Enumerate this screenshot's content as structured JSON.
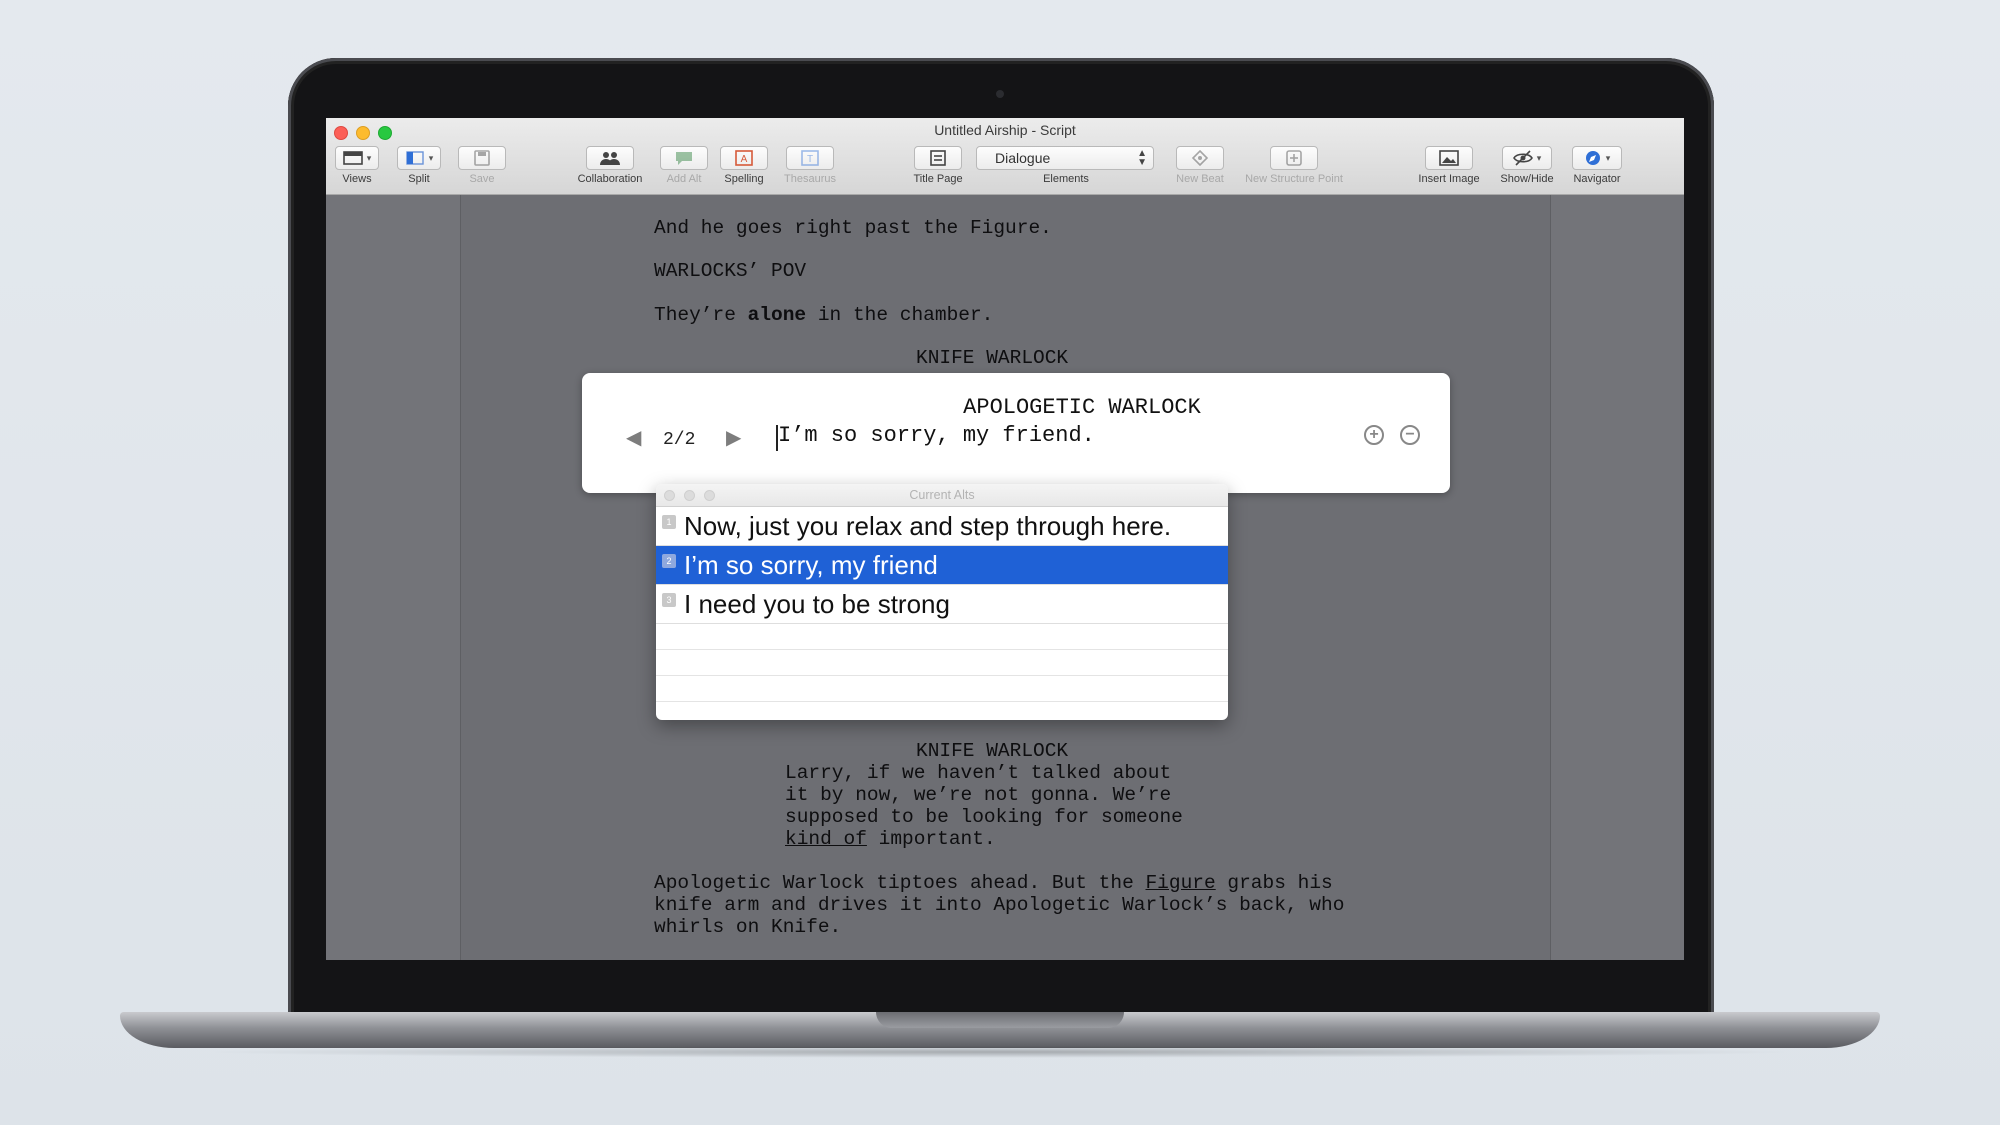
{
  "window": {
    "title": "Untitled Airship - Script"
  },
  "toolbar": {
    "views": "Views",
    "split": "Split",
    "save": "Save",
    "collaboration": "Collaboration",
    "add_alt": "Add Alt",
    "spelling": "Spelling",
    "thesaurus": "Thesaurus",
    "title_page": "Title Page",
    "elements_value": "Dialogue",
    "elements": "Elements",
    "new_beat": "New Beat",
    "new_structure_point": "New Structure Point",
    "insert_image": "Insert Image",
    "show_hide": "Show/Hide",
    "navigator": "Navigator"
  },
  "script": {
    "line1": "And he goes right past the Figure.",
    "line2": "WARLOCKS’ POV",
    "line3_a": "They’re ",
    "line3_b": "alone",
    "line3_c": " in the chamber.",
    "char1": "KNIFE WARLOCK",
    "char2": "KNIFE WARLOCK",
    "dlg1": "Larry, if we haven’t talked about",
    "dlg2": "it by now, we’re not gonna. We’re",
    "dlg3": "supposed to be looking for someone",
    "dlg4_a": "kind of",
    "dlg4_b": " important.",
    "act1_a": "Apologetic Warlock tiptoes ahead. But the ",
    "act1_b": "Figure",
    "act1_c": " grabs his",
    "act2": "knife arm and drives it into Apologetic Warlock’s back, who",
    "act3": "whirls on Knife."
  },
  "alt_popup": {
    "count": "2/2",
    "character": "APOLOGETIC WARLOCK",
    "line": "I’m so sorry, my friend."
  },
  "alts_panel": {
    "title": "Current Alts",
    "items": [
      {
        "num": "1",
        "text": "Now, just you relax and step through here."
      },
      {
        "num": "2",
        "text": "I’m so sorry, my friend"
      },
      {
        "num": "3",
        "text": "I need you to be strong"
      }
    ],
    "selected_index": 1,
    "colors": {
      "selection": "#1f61d6"
    }
  }
}
